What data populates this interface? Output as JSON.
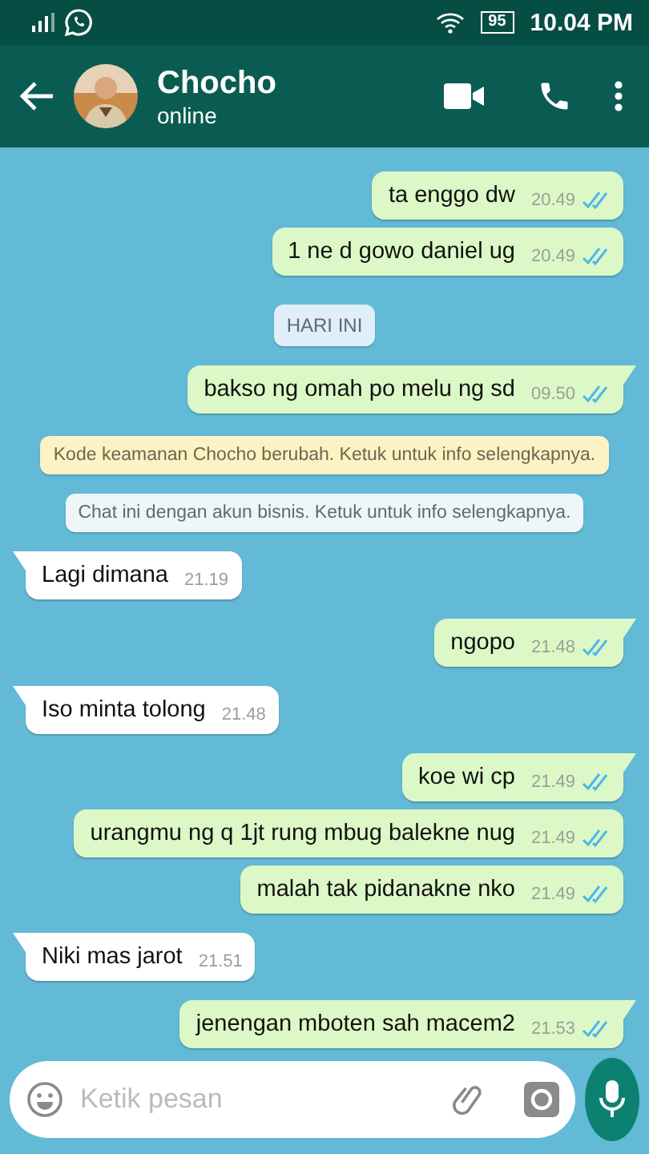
{
  "status_bar": {
    "battery": "95",
    "time": "10.04 PM"
  },
  "header": {
    "name": "Chocho",
    "status": "online"
  },
  "messages": [
    {
      "kind": "out",
      "text": "ta enggo dw",
      "time": "20.49",
      "read": true,
      "tail": false
    },
    {
      "kind": "out",
      "text": "1 ne d gowo daniel ug",
      "time": "20.49",
      "read": true,
      "tail": false
    },
    {
      "kind": "date",
      "text": "HARI INI"
    },
    {
      "kind": "out",
      "text": "bakso ng omah po melu ng sd",
      "time": "09.50",
      "read": true,
      "tail": true
    },
    {
      "kind": "security",
      "text": "Kode keamanan Chocho berubah. Ketuk untuk info selengkapnya."
    },
    {
      "kind": "business",
      "text": "Chat ini dengan akun bisnis. Ketuk untuk info selengkapnya."
    },
    {
      "kind": "in",
      "text": "Lagi dimana",
      "time": "21.19",
      "tail": true
    },
    {
      "kind": "out",
      "text": "ngopo",
      "time": "21.48",
      "read": true,
      "tail": true
    },
    {
      "kind": "in",
      "text": "Iso minta tolong",
      "time": "21.48",
      "tail": true
    },
    {
      "kind": "out",
      "text": "koe wi cp",
      "time": "21.49",
      "read": true,
      "tail": true
    },
    {
      "kind": "out",
      "text": "urangmu ng q 1jt rung mbug balekne nug",
      "time": "21.49",
      "read": true,
      "tail": false
    },
    {
      "kind": "out",
      "text": "malah tak pidanakne nko",
      "time": "21.49",
      "read": true,
      "tail": false
    },
    {
      "kind": "in",
      "text": "Niki mas jarot",
      "time": "21.51",
      "tail": true
    },
    {
      "kind": "out",
      "text": "jenengan mboten sah macem2",
      "time": "21.53",
      "read": true,
      "tail": true
    }
  ],
  "composer": {
    "placeholder": "Ketik pesan"
  }
}
